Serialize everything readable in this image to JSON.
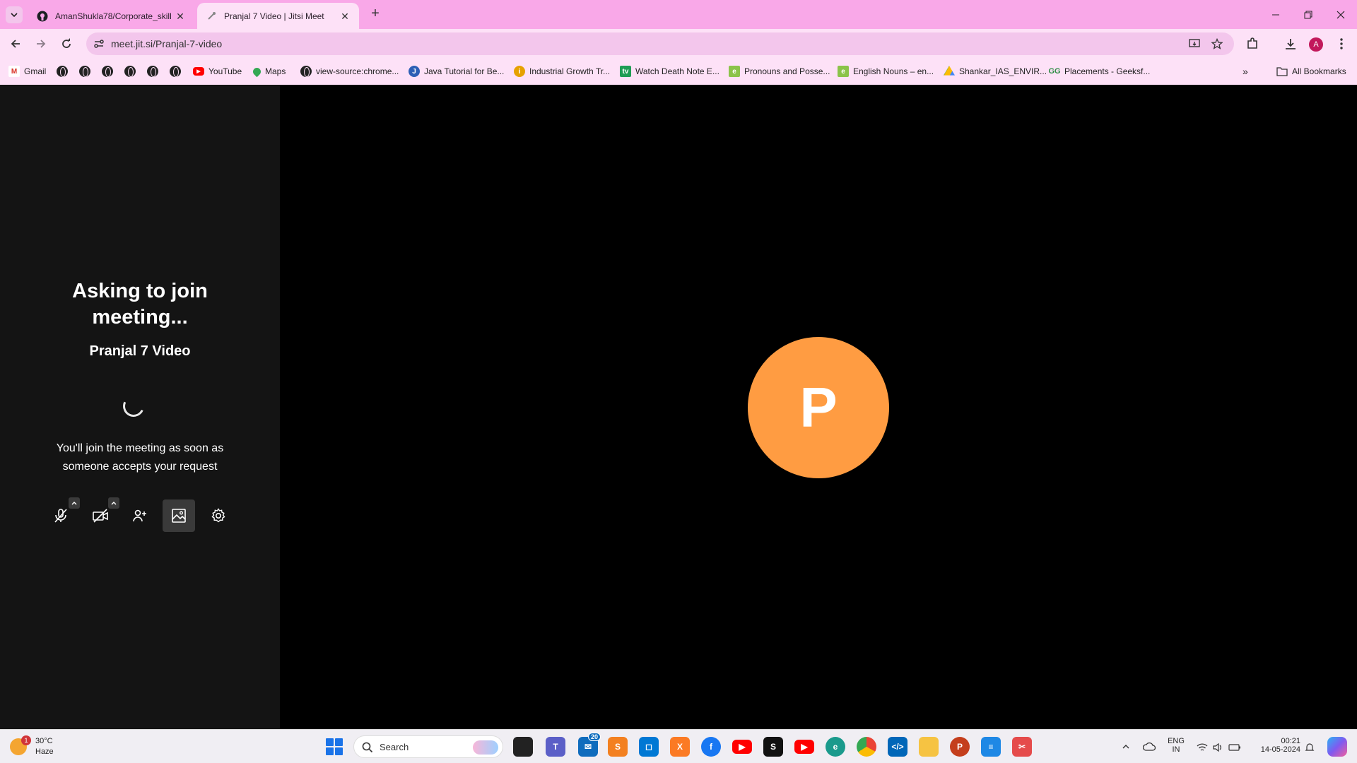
{
  "browser": {
    "tabs": [
      {
        "title": "AmanShukla78/Corporate_skill",
        "active": false
      },
      {
        "title": "Pranjal 7 Video | Jitsi Meet",
        "active": true
      }
    ],
    "url": "meet.jit.si/Pranjal-7-video",
    "profile_initial": "A",
    "bookmarks": [
      {
        "label": "Gmail",
        "icon": "gmail-icon"
      },
      {
        "label": "YouTube",
        "icon": "youtube-icon"
      },
      {
        "label": "Maps",
        "icon": "maps-icon"
      },
      {
        "label": "view-source:chrome...",
        "icon": "globe-icon"
      },
      {
        "label": "Java Tutorial for Be...",
        "icon": "java-icon"
      },
      {
        "label": "Industrial Growth Tr...",
        "icon": "bulb-icon"
      },
      {
        "label": "Watch Death Note E...",
        "icon": "tv-icon"
      },
      {
        "label": "Pronouns and Posse...",
        "icon": "e-icon"
      },
      {
        "label": "English Nouns – en...",
        "icon": "e-icon"
      },
      {
        "label": "Shankar_IAS_ENVIR...",
        "icon": "drive-icon"
      },
      {
        "label": "Placements - Geeksf...",
        "icon": "gfg-icon"
      }
    ],
    "all_bookmarks_label": "All Bookmarks"
  },
  "meeting": {
    "status_title": "Asking to join meeting...",
    "room_name": "Pranjal 7 Video",
    "message": "You'll join the meeting as soon as someone accepts your request",
    "participant_initial": "P",
    "avatar_color": "#ff9c42"
  },
  "taskbar": {
    "weather_temp": "30°C",
    "weather_desc": "Haze",
    "weather_badge": "1",
    "search_placeholder": "Search",
    "mail_badge": "20",
    "language": "ENG",
    "region": "IN",
    "time": "00:21",
    "date": "14-05-2024"
  }
}
